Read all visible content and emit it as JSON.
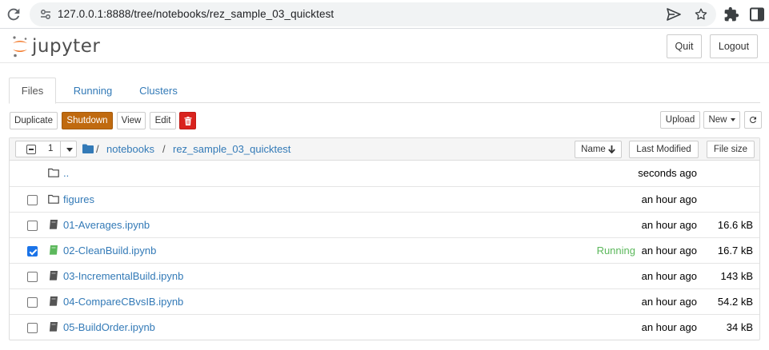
{
  "browser": {
    "url": "127.0.0.1:8888/tree/notebooks/rez_sample_03_quicktest"
  },
  "header": {
    "logo_text": "jupyter",
    "quit_label": "Quit",
    "logout_label": "Logout"
  },
  "tabs": [
    {
      "label": "Files",
      "active": true
    },
    {
      "label": "Running",
      "active": false
    },
    {
      "label": "Clusters",
      "active": false
    }
  ],
  "toolbar": {
    "duplicate": "Duplicate",
    "shutdown": "Shutdown",
    "view": "View",
    "edit": "Edit",
    "upload": "Upload",
    "new": "New"
  },
  "list_header": {
    "selected_count": "1",
    "breadcrumb_sep1": "/",
    "breadcrumb_notebooks": "notebooks",
    "breadcrumb_sep2": "/",
    "breadcrumb_current": "rez_sample_03_quicktest",
    "sort_name": "Name",
    "sort_modified": "Last Modified",
    "sort_size": "File size"
  },
  "rows": [
    {
      "type": "parent",
      "name": "..",
      "checked": false,
      "modified": "seconds ago",
      "size": "",
      "status": ""
    },
    {
      "type": "folder",
      "name": "figures",
      "checked": false,
      "modified": "an hour ago",
      "size": "",
      "status": ""
    },
    {
      "type": "notebook",
      "name": "01-Averages.ipynb",
      "checked": false,
      "modified": "an hour ago",
      "size": "16.6 kB",
      "status": ""
    },
    {
      "type": "notebook-running",
      "name": "02-CleanBuild.ipynb",
      "checked": true,
      "modified": "an hour ago",
      "size": "16.7 kB",
      "status": "Running"
    },
    {
      "type": "notebook",
      "name": "03-IncrementalBuild.ipynb",
      "checked": false,
      "modified": "an hour ago",
      "size": "143 kB",
      "status": ""
    },
    {
      "type": "notebook",
      "name": "04-CompareCBvsIB.ipynb",
      "checked": false,
      "modified": "an hour ago",
      "size": "54.2 kB",
      "status": ""
    },
    {
      "type": "notebook",
      "name": "05-BuildOrder.ipynb",
      "checked": false,
      "modified": "an hour ago",
      "size": "34 kB",
      "status": ""
    }
  ],
  "colors": {
    "link": "#337ab7",
    "running": "#5cb85c",
    "shutdown_bg": "#c06a0f",
    "delete_bg": "#d9231e",
    "jupyter_orange": "#f37726"
  }
}
